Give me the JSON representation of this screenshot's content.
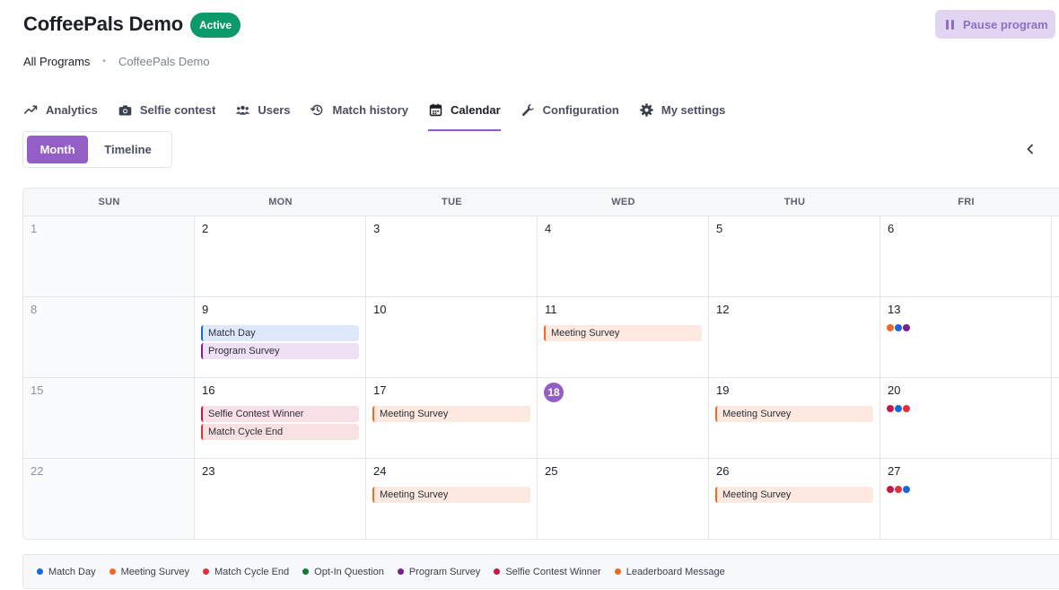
{
  "header": {
    "title": "CoffeePals Demo",
    "status": "Active",
    "pause_label": "Pause program"
  },
  "breadcrumb": {
    "root": "All Programs",
    "separator": "•",
    "current": "CoffeePals Demo"
  },
  "tabs": [
    {
      "label": "Analytics",
      "icon": "trend-icon"
    },
    {
      "label": "Selfie contest",
      "icon": "camera-icon"
    },
    {
      "label": "Users",
      "icon": "users-icon"
    },
    {
      "label": "Match history",
      "icon": "history-icon"
    },
    {
      "label": "Calendar",
      "icon": "calendar-icon",
      "active": true
    },
    {
      "label": "Configuration",
      "icon": "wrench-icon"
    },
    {
      "label": "My settings",
      "icon": "gear-icon"
    }
  ],
  "view_toggle": {
    "month": "Month",
    "timeline": "Timeline",
    "selected": "Month"
  },
  "calendar": {
    "weekdays": [
      "SUN",
      "MON",
      "TUE",
      "WED",
      "THU",
      "FRI"
    ],
    "today": 18,
    "weeks": [
      [
        {
          "day": "1",
          "events": []
        },
        {
          "day": "2",
          "events": []
        },
        {
          "day": "3",
          "events": []
        },
        {
          "day": "4",
          "events": []
        },
        {
          "day": "5",
          "events": []
        },
        {
          "day": "6",
          "events": []
        }
      ],
      [
        {
          "day": "8",
          "events": []
        },
        {
          "day": "9",
          "events": [
            {
              "label": "Match Day",
              "type": "match"
            },
            {
              "label": "Program Survey",
              "type": "program"
            }
          ]
        },
        {
          "day": "10",
          "events": []
        },
        {
          "day": "11",
          "events": [
            {
              "label": "Meeting Survey",
              "type": "meeting"
            }
          ]
        },
        {
          "day": "12",
          "events": []
        },
        {
          "day": "13",
          "events": [],
          "dots": [
            "#f06a22",
            "#1a67e3",
            "#7c1e96"
          ]
        }
      ],
      [
        {
          "day": "15",
          "events": []
        },
        {
          "day": "16",
          "events": [
            {
              "label": "Selfie Contest Winner",
              "type": "selfie"
            },
            {
              "label": "Match Cycle End",
              "type": "cycle"
            }
          ]
        },
        {
          "day": "17",
          "events": [
            {
              "label": "Meeting Survey",
              "type": "meeting"
            }
          ]
        },
        {
          "day": "18",
          "events": [],
          "today": true
        },
        {
          "day": "19",
          "events": [
            {
              "label": "Meeting Survey",
              "type": "meeting"
            }
          ]
        },
        {
          "day": "20",
          "events": [],
          "dots": [
            "#c41a46",
            "#1a67e3",
            "#e0303a"
          ]
        }
      ],
      [
        {
          "day": "22",
          "events": []
        },
        {
          "day": "23",
          "events": []
        },
        {
          "day": "24",
          "events": [
            {
              "label": "Meeting Survey",
              "type": "meeting"
            }
          ]
        },
        {
          "day": "25",
          "events": []
        },
        {
          "day": "26",
          "events": [
            {
              "label": "Meeting Survey",
              "type": "meeting"
            }
          ]
        },
        {
          "day": "27",
          "events": [],
          "dots": [
            "#c41a46",
            "#e0303a",
            "#1a67e3"
          ]
        }
      ]
    ]
  },
  "legend": [
    {
      "label": "Match Day",
      "color": "#1a67e3"
    },
    {
      "label": "Meeting Survey",
      "color": "#f06a22"
    },
    {
      "label": "Match Cycle End",
      "color": "#e0303a"
    },
    {
      "label": "Opt-In Question",
      "color": "#0e7a3a"
    },
    {
      "label": "Program Survey",
      "color": "#7c1e96"
    },
    {
      "label": "Selfie Contest Winner",
      "color": "#c41a46"
    },
    {
      "label": "Leaderboard Message",
      "color": "#f06a22"
    }
  ],
  "colors": {
    "accent": "#935ec6",
    "active_badge": "#0c9a6a"
  }
}
